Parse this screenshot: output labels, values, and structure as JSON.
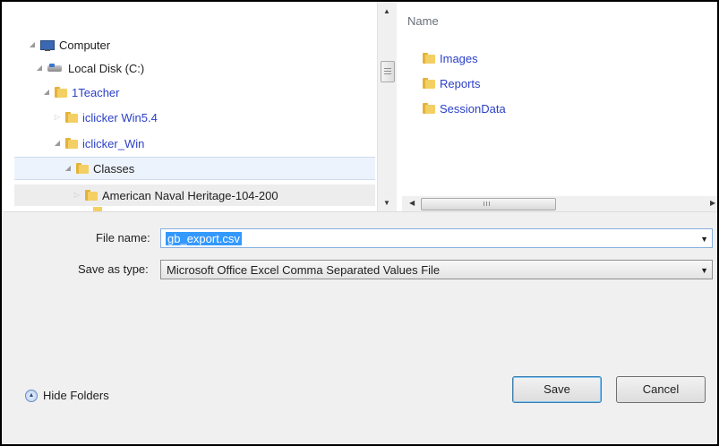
{
  "tree": {
    "items": [
      {
        "label": "Computer",
        "icon": "computer-icon"
      },
      {
        "label": "Local Disk (C:)",
        "icon": "disk-icon"
      },
      {
        "label": "1Teacher",
        "icon": "folder-icon"
      },
      {
        "label": "iclicker Win5.4",
        "icon": "folder-icon"
      },
      {
        "label": "iclicker_Win",
        "icon": "folder-icon"
      },
      {
        "label": "Classes",
        "icon": "folder-icon"
      },
      {
        "label": "American Naval Heritage-104-200",
        "icon": "folder-icon"
      }
    ]
  },
  "files": {
    "column_name": "Name",
    "items": [
      {
        "label": "Images"
      },
      {
        "label": "Reports"
      },
      {
        "label": "SessionData"
      }
    ]
  },
  "form": {
    "file_name_label": "File name:",
    "file_name_value": "gb_export.csv",
    "save_type_label": "Save as type:",
    "save_type_value": "Microsoft Office Excel Comma Separated Values File"
  },
  "footer": {
    "hide_folders_label": "Hide Folders",
    "save_label": "Save",
    "cancel_label": "Cancel"
  },
  "colors": {
    "link_blue": "#2a3fc7",
    "selection_blue": "#3399ff",
    "folder_yellow": "#f4cf63"
  }
}
